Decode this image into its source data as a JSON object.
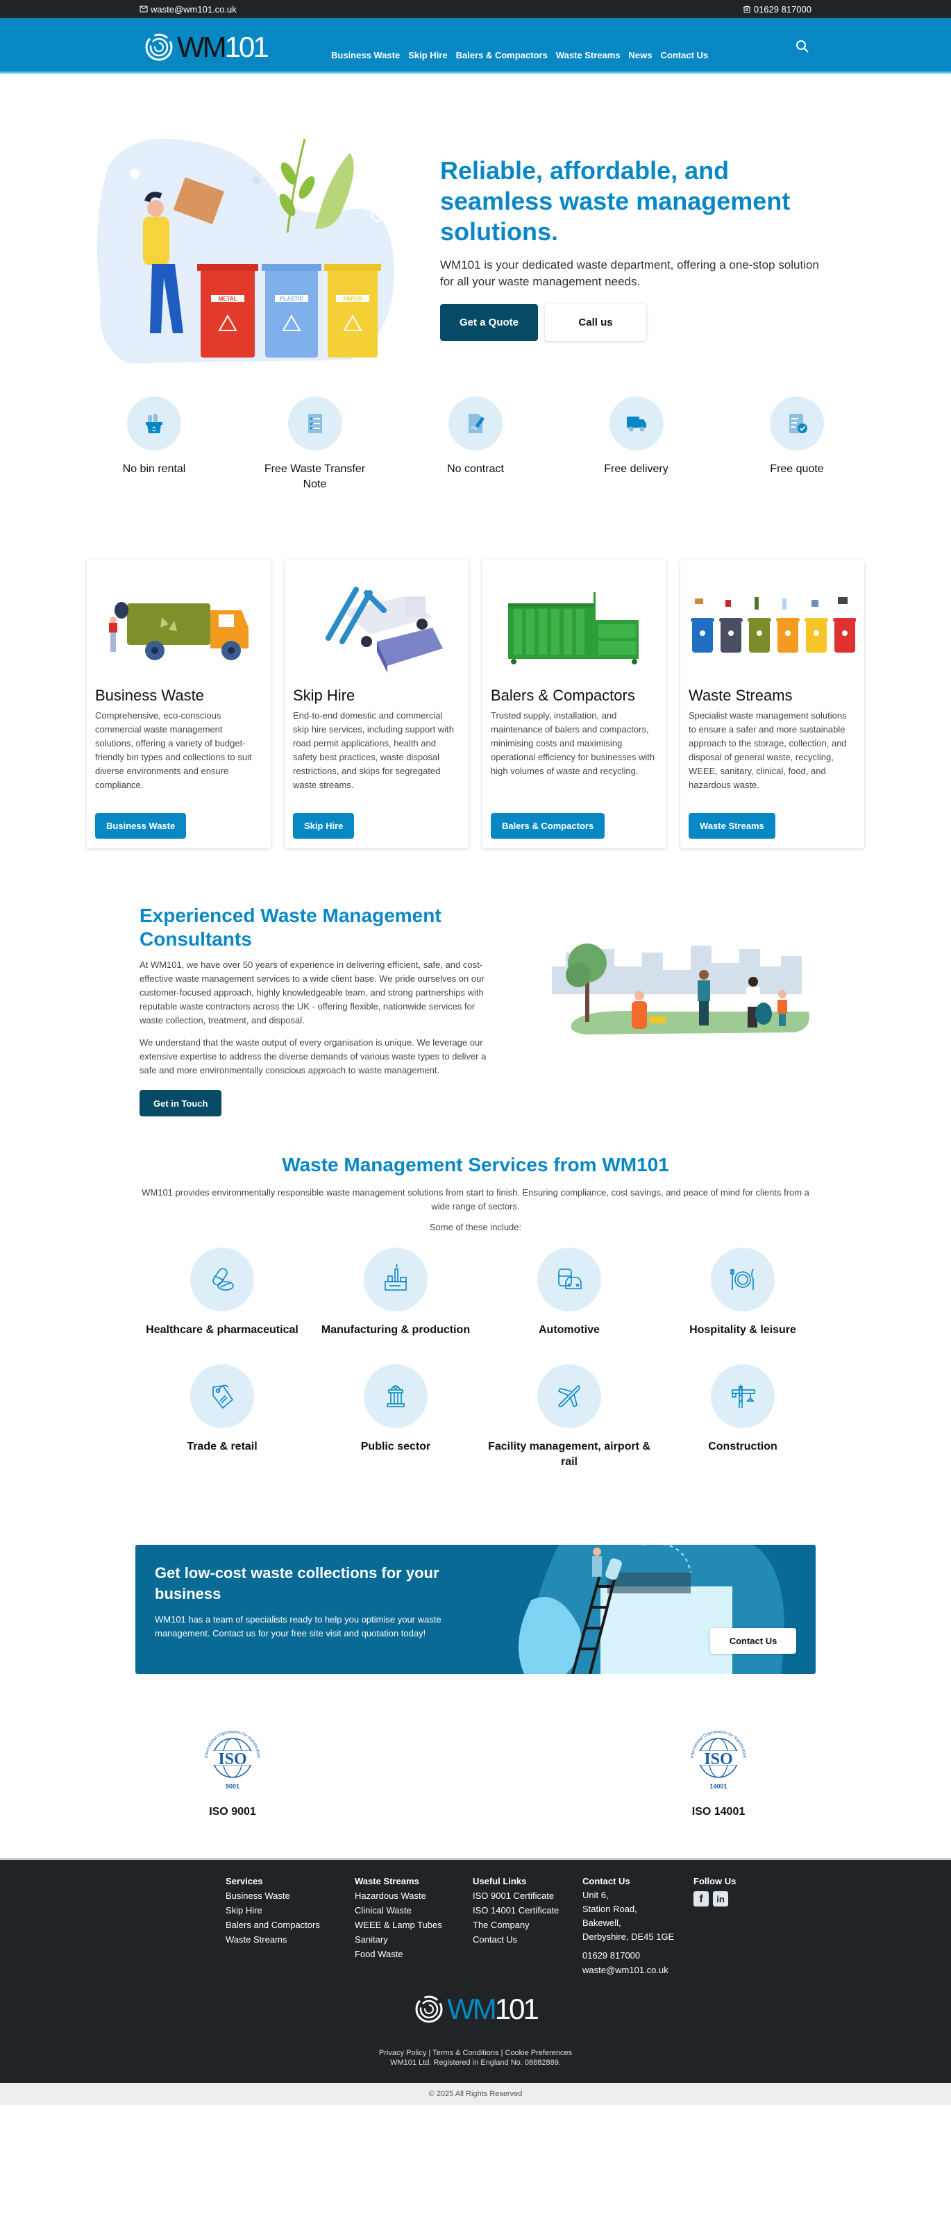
{
  "topbar": {
    "email": "waste@wm101.co.uk",
    "phone": "01629 817000"
  },
  "nav": {
    "logo_text_dark": "WM",
    "logo_text_light": "101",
    "items": [
      {
        "label": "Business Waste"
      },
      {
        "label": "Skip Hire"
      },
      {
        "label": "Balers & Compactors"
      },
      {
        "label": "Waste Streams"
      },
      {
        "label": "News"
      },
      {
        "label": "Contact Us"
      }
    ]
  },
  "hero": {
    "title": "Reliable, affordable, and seamless waste management solutions.",
    "subtitle": "WM101 is your dedicated waste department, offering a one-stop solution for all your waste management needs.",
    "primary_button": "Get a Quote",
    "secondary_button": "Call us",
    "bin_labels": [
      "METAL",
      "PLASTIC",
      "PAPER"
    ]
  },
  "features": [
    {
      "label": "No bin rental",
      "icon": "recycle-basket-icon"
    },
    {
      "label": "Free Waste Transfer Note",
      "icon": "checklist-icon"
    },
    {
      "label": "No contract",
      "icon": "signed-document-icon"
    },
    {
      "label": "Free delivery",
      "icon": "truck-icon"
    },
    {
      "label": "Free quote",
      "icon": "quote-check-icon"
    }
  ],
  "cards": [
    {
      "title": "Business Waste",
      "text": "Comprehensive, eco-conscious commercial waste management solutions, offering a variety of budget-friendly bin types and collections to suit diverse environments and ensure compliance.",
      "button": "Business Waste"
    },
    {
      "title": "Skip Hire",
      "text": "End-to-end domestic and commercial skip hire services, including support with road permit applications, health and safety best practices, waste disposal restrictions, and skips for segregated waste streams.",
      "button": "Skip Hire"
    },
    {
      "title": "Balers & Compactors",
      "text": "Trusted supply, installation, and maintenance of balers and compactors, minimising costs and maximising operational efficiency for businesses with high volumes of waste and recycling.",
      "button": "Balers & Compactors"
    },
    {
      "title": "Waste Streams",
      "text": "Specialist waste management solutions to ensure a safer and more sustainable approach to the storage, collection, and disposal of general waste, recycling, WEEE, sanitary, clinical, food, and hazardous waste.",
      "button": "Waste Streams"
    }
  ],
  "consultants": {
    "title": "Experienced Waste Management Consultants",
    "paragraph1": "At WM101, we have over 50 years of experience in delivering efficient, safe, and cost-effective waste management services to a wide client base. We pride ourselves on our customer-focused approach, highly knowledgeable team, and strong partnerships with reputable waste contractors across the UK - offering flexible, nationwide services for waste collection, treatment, and disposal.",
    "paragraph2": "We understand that the waste output of every organisation is unique. We leverage our extensive expertise to address the diverse demands of various waste types to deliver a safe and more environmentally conscious approach to waste management.",
    "button": "Get in Touch"
  },
  "sectors": {
    "title": "Waste Management Services from WM101",
    "intro": "WM101 provides environmentally responsible waste management solutions from start to finish. Ensuring compliance, cost savings, and peace of mind for clients from a wide range of sectors.",
    "some": "Some of these include:",
    "items": [
      {
        "label": "Healthcare & pharmaceutical"
      },
      {
        "label": "Manufacturing & production"
      },
      {
        "label": "Automotive"
      },
      {
        "label": "Hospitality & leisure"
      },
      {
        "label": "Trade & retail"
      },
      {
        "label": "Public sector"
      },
      {
        "label": "Facility management, airport & rail"
      },
      {
        "label": "Construction"
      }
    ]
  },
  "cta": {
    "title": "Get low-cost waste collections for your business",
    "text": "WM101 has a team of specialists ready to help you optimise your waste management. Contact us for your free site visit and quotation today!",
    "button": "Contact Us"
  },
  "iso": [
    {
      "label": "ISO 9001",
      "number": "9001",
      "ring_text": "International Organization for Standardization"
    },
    {
      "label": "ISO 14001",
      "number": "14001",
      "ring_text": "International Organization for Standardization"
    }
  ],
  "footer": {
    "services": {
      "heading": "Services",
      "links": [
        "Business Waste",
        "Skip Hire",
        "Balers and Compactors",
        "Waste Streams"
      ]
    },
    "streams": {
      "heading": "Waste Streams",
      "links": [
        "Hazardous Waste",
        "Clinical Waste",
        "WEEE & Lamp Tubes",
        "Sanitary",
        "Food Waste"
      ]
    },
    "useful": {
      "heading": "Useful Links",
      "links": [
        "ISO 9001 Certificate",
        "ISO 14001 Certificate",
        "The Company",
        "Contact Us"
      ]
    },
    "contact": {
      "heading": "Contact Us",
      "address": [
        "Unit 6,",
        "Station Road,",
        "Bakewell,",
        "Derbyshire, DE45 1GE"
      ],
      "phone": "01629 817000",
      "email": "waste@wm101.co.uk"
    },
    "follow": {
      "heading": "Follow Us",
      "facebook": "f",
      "linkedin": "in"
    },
    "legal": {
      "privacy": "Privacy Policy",
      "terms": "Terms & Conditions",
      "cookies": "Cookie Preferences",
      "separator": "|",
      "registered": "WM101 Ltd. Registered in England No. 08882889."
    },
    "copyright": "© 2025 All Rights Reserved"
  },
  "colors": {
    "brand_blue": "#0788c5",
    "dark_teal": "#064a66",
    "footer_bg": "#212427",
    "icon_circle": "#deeef8"
  }
}
